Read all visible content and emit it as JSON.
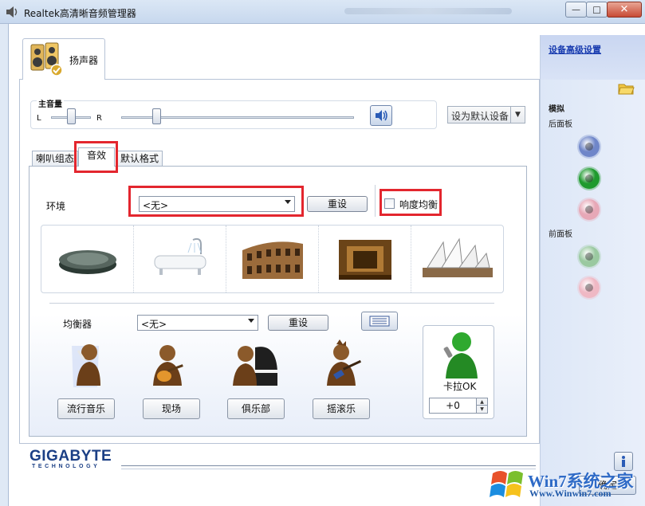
{
  "window": {
    "title": "Realtek高清晰音频管理器",
    "controls": {
      "minimize": "—",
      "maximize": "□",
      "close": "✕"
    }
  },
  "device_tab": {
    "label": "扬声器"
  },
  "master_volume": {
    "title": "主音量",
    "left_label": "L",
    "right_label": "R",
    "balance_fraction": 0.5,
    "volume_fraction": 0.15
  },
  "default_device": {
    "label": "设为默认设备"
  },
  "tabs": [
    {
      "label": "喇叭组态",
      "active": false
    },
    {
      "label": "音效",
      "active": true
    },
    {
      "label": "默认格式",
      "active": false
    }
  ],
  "environment": {
    "label": "环境",
    "selected": "<无>",
    "reset_label": "重设",
    "loudness_label": "响度均衡",
    "loudness_checked": false,
    "presets": [
      "stone-icon",
      "bathtub-icon",
      "colosseum-icon",
      "wooden-room-icon",
      "opera-house-icon"
    ]
  },
  "equalizer": {
    "label": "均衡器",
    "selected": "<无>",
    "reset_label": "重设",
    "presets": [
      {
        "label": "流行音乐",
        "icon": "pop-singer-icon"
      },
      {
        "label": "现场",
        "icon": "live-guitarist-icon"
      },
      {
        "label": "俱乐部",
        "icon": "club-pianist-icon"
      },
      {
        "label": "摇滚乐",
        "icon": "rock-guitarist-icon"
      }
    ]
  },
  "karaoke": {
    "label": "卡拉OK",
    "value": "+0"
  },
  "side_panel": {
    "advanced_link": "设备高级设置",
    "analog_label": "模拟",
    "back_panel_label": "后面板",
    "front_panel_label": "前面板",
    "colors": {
      "blue": "#6f86c9",
      "green": "#1f9a2e",
      "pink": "#e7a8b7",
      "pale_green": "#9ac9a0",
      "pale_pink": "#efb8c4"
    }
  },
  "footer": {
    "brand": "GIGABYTE",
    "brand_sub": "TECHNOLOGY",
    "ok_label": "确定",
    "watermark": "Win7系统之家",
    "watermark_url": "Www.Winwin7.com"
  }
}
